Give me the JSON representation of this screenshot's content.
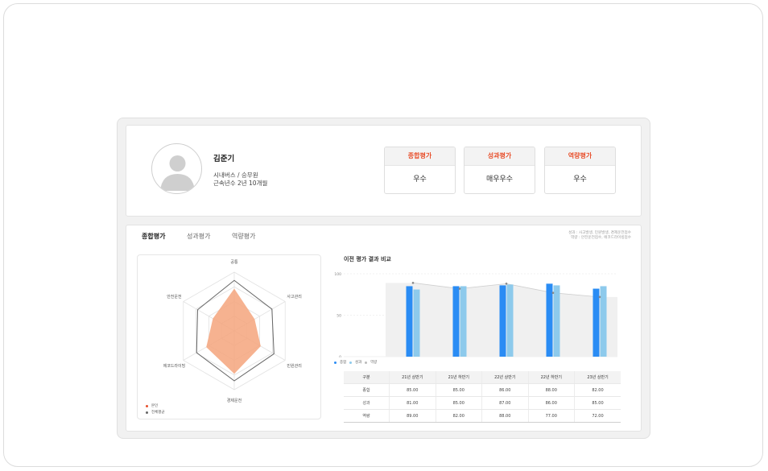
{
  "profile": {
    "name": "김준기",
    "role": "시내버스 / 승무원",
    "tenure": "근속년수 2년 10개월"
  },
  "cards": [
    {
      "label": "종합평가",
      "value": "우수"
    },
    {
      "label": "성과평가",
      "value": "매우우수"
    },
    {
      "label": "역량평가",
      "value": "우수"
    }
  ],
  "tabs": [
    "종합평가",
    "성과평가",
    "역량평가"
  ],
  "notes": {
    "line1": "성과 : 사고발생, 민원발생, 경제운전점수",
    "line2": "역량 : 안전운전점수, 에코드라이빙점수"
  },
  "radar": {
    "axes": [
      "공통",
      "사고관리",
      "민원관리",
      "경제운전",
      "에코드라이빙",
      "안전운전"
    ],
    "legend": [
      "본인",
      "전체평균"
    ],
    "self_values": [
      0.72,
      0.4,
      0.52,
      0.73,
      0.55,
      0.42
    ],
    "avg_values": [
      0.86,
      0.74,
      0.78,
      0.85,
      0.74,
      0.72
    ],
    "colors": {
      "self": "#f5a57c",
      "avg": "#666666"
    }
  },
  "chart_data": {
    "type": "bar",
    "title": "이전 평가 결과 비교",
    "categories": [
      "21년 상반기",
      "21년 하반기",
      "22년 상반기",
      "22년 하반기",
      "23년 상반기"
    ],
    "series": [
      {
        "name": "종합",
        "values": [
          85.0,
          85.0,
          86.0,
          88.0,
          82.0
        ],
        "color": "#2a8cf4",
        "mark": "dot"
      },
      {
        "name": "성과",
        "values": [
          81.0,
          85.0,
          87.0,
          86.0,
          85.0
        ],
        "color": "#8dcaec"
      },
      {
        "name": "역량",
        "values": [
          89.0,
          82.0,
          88.0,
          77.0,
          72.0
        ],
        "color": "#bbbbbb"
      }
    ],
    "ylim": [
      0,
      100
    ],
    "yticks": [
      "0",
      "50",
      "100"
    ],
    "grid": true
  },
  "table": {
    "headers": [
      "구분",
      "21년 상반기",
      "21년 하반기",
      "22년 상반기",
      "22년 하반기",
      "23년 상반기"
    ],
    "rows": [
      [
        "종합",
        "85.00",
        "85.00",
        "86.00",
        "88.00",
        "82.00"
      ],
      [
        "성과",
        "81.00",
        "85.00",
        "87.00",
        "86.00",
        "85.00"
      ],
      [
        "역량",
        "89.00",
        "82.00",
        "88.00",
        "77.00",
        "72.00"
      ]
    ]
  }
}
